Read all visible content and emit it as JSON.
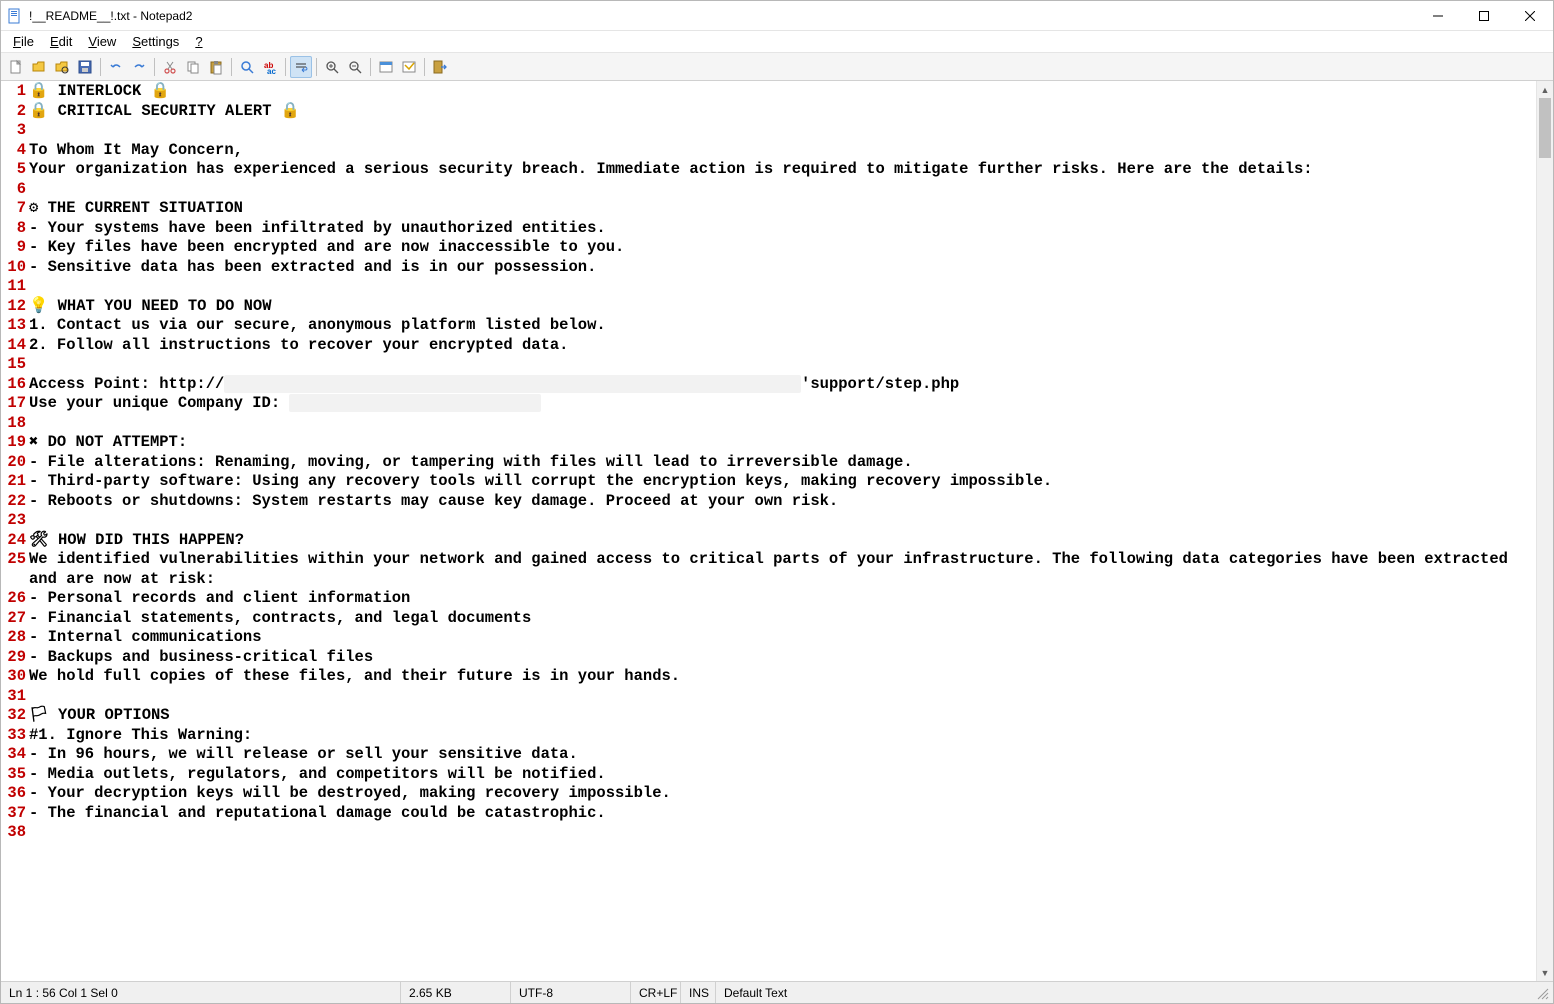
{
  "window": {
    "title": "!__README__!.txt - Notepad2"
  },
  "menu": {
    "file": "File",
    "edit": "Edit",
    "view": "View",
    "settings": "Settings",
    "help": "?"
  },
  "toolbar_icons": {
    "new": "new-file-icon",
    "open": "open-file-icon",
    "browse": "browse-icon",
    "save": "save-icon",
    "undo": "undo-icon",
    "redo": "redo-icon",
    "cut": "cut-icon",
    "copy": "copy-icon",
    "paste": "paste-icon",
    "find": "find-icon",
    "replace": "replace-icon",
    "wordwrap": "word-wrap-icon",
    "zoomin": "zoom-in-icon",
    "zoomout": "zoom-out-icon",
    "scheme": "scheme-icon",
    "customize": "customize-icon",
    "exit": "exit-icon"
  },
  "lines": [
    {
      "n": 1,
      "segments": [
        {
          "t": "🔒 INTERLOCK 🔒"
        }
      ]
    },
    {
      "n": 2,
      "segments": [
        {
          "t": "🔒 CRITICAL SECURITY ALERT 🔒"
        }
      ]
    },
    {
      "n": 3,
      "segments": [
        {
          "t": ""
        }
      ]
    },
    {
      "n": 4,
      "segments": [
        {
          "t": "To Whom It May Concern,"
        }
      ]
    },
    {
      "n": 5,
      "segments": [
        {
          "t": "Your organization has experienced a serious security breach. Immediate action is required to mitigate further risks. Here are the details:"
        }
      ]
    },
    {
      "n": 6,
      "segments": [
        {
          "t": ""
        }
      ]
    },
    {
      "n": 7,
      "segments": [
        {
          "t": "⚙ THE CURRENT SITUATION"
        }
      ]
    },
    {
      "n": 8,
      "segments": [
        {
          "t": "- Your systems have been infiltrated by unauthorized entities."
        }
      ]
    },
    {
      "n": 9,
      "segments": [
        {
          "t": "- Key files have been encrypted and are now inaccessible to you."
        }
      ]
    },
    {
      "n": 10,
      "segments": [
        {
          "t": "- Sensitive data has been extracted and is in our possession."
        }
      ]
    },
    {
      "n": 11,
      "segments": [
        {
          "t": ""
        }
      ]
    },
    {
      "n": 12,
      "segments": [
        {
          "t": "💡 WHAT YOU NEED TO DO NOW"
        }
      ]
    },
    {
      "n": 13,
      "segments": [
        {
          "t": "1. Contact us via our secure, anonymous platform listed below."
        }
      ]
    },
    {
      "n": 14,
      "segments": [
        {
          "t": "2. Follow all instructions to recover your encrypted data."
        }
      ]
    },
    {
      "n": 15,
      "segments": [
        {
          "t": ""
        }
      ]
    },
    {
      "n": 16,
      "segments": [
        {
          "t": "Access Point: http://"
        },
        {
          "t": "                                                              ",
          "redact": true
        },
        {
          "t": "'support/step.php"
        }
      ]
    },
    {
      "n": 17,
      "segments": [
        {
          "t": "Use your unique Company ID: "
        },
        {
          "t": "                           ",
          "redact": true
        }
      ]
    },
    {
      "n": 18,
      "segments": [
        {
          "t": ""
        }
      ]
    },
    {
      "n": 19,
      "segments": [
        {
          "t": "✖ DO NOT ATTEMPT:"
        }
      ]
    },
    {
      "n": 20,
      "segments": [
        {
          "t": "- File alterations: Renaming, moving, or tampering with files will lead to irreversible damage."
        }
      ]
    },
    {
      "n": 21,
      "segments": [
        {
          "t": "- Third-party software: Using any recovery tools will corrupt the encryption keys, making recovery impossible."
        }
      ]
    },
    {
      "n": 22,
      "segments": [
        {
          "t": "- Reboots or shutdowns: System restarts may cause key damage. Proceed at your own risk."
        }
      ]
    },
    {
      "n": 23,
      "segments": [
        {
          "t": ""
        }
      ]
    },
    {
      "n": 24,
      "segments": [
        {
          "t": "🛠 HOW DID THIS HAPPEN?"
        }
      ]
    },
    {
      "n": 25,
      "segments": [
        {
          "t": "We identified vulnerabilities within your network and gained access to critical parts of your infrastructure. The following data categories have been extracted and are now at risk:"
        }
      ]
    },
    {
      "n": 26,
      "segments": [
        {
          "t": "- Personal records and client information"
        }
      ]
    },
    {
      "n": 27,
      "segments": [
        {
          "t": "- Financial statements, contracts, and legal documents"
        }
      ]
    },
    {
      "n": 28,
      "segments": [
        {
          "t": "- Internal communications"
        }
      ]
    },
    {
      "n": 29,
      "segments": [
        {
          "t": "- Backups and business-critical files"
        }
      ]
    },
    {
      "n": 30,
      "segments": [
        {
          "t": "We hold full copies of these files, and their future is in your hands."
        }
      ]
    },
    {
      "n": 31,
      "segments": [
        {
          "t": ""
        }
      ]
    },
    {
      "n": 32,
      "segments": [
        {
          "t": "🏳 YOUR OPTIONS"
        }
      ]
    },
    {
      "n": 33,
      "segments": [
        {
          "t": "#1. Ignore This Warning:"
        }
      ]
    },
    {
      "n": 34,
      "segments": [
        {
          "t": "- In 96 hours, we will release or sell your sensitive data."
        }
      ]
    },
    {
      "n": 35,
      "segments": [
        {
          "t": "- Media outlets, regulators, and competitors will be notified."
        }
      ]
    },
    {
      "n": 36,
      "segments": [
        {
          "t": "- Your decryption keys will be destroyed, making recovery impossible."
        }
      ]
    },
    {
      "n": 37,
      "segments": [
        {
          "t": "- The financial and reputational damage could be catastrophic."
        }
      ]
    },
    {
      "n": 38,
      "segments": [
        {
          "t": ""
        }
      ]
    }
  ],
  "status": {
    "pos": "Ln 1 : 56   Col 1   Sel 0",
    "size": "2.65 KB",
    "encoding": "UTF-8",
    "eol": "CR+LF",
    "ins": "INS",
    "filetype": "Default Text"
  }
}
